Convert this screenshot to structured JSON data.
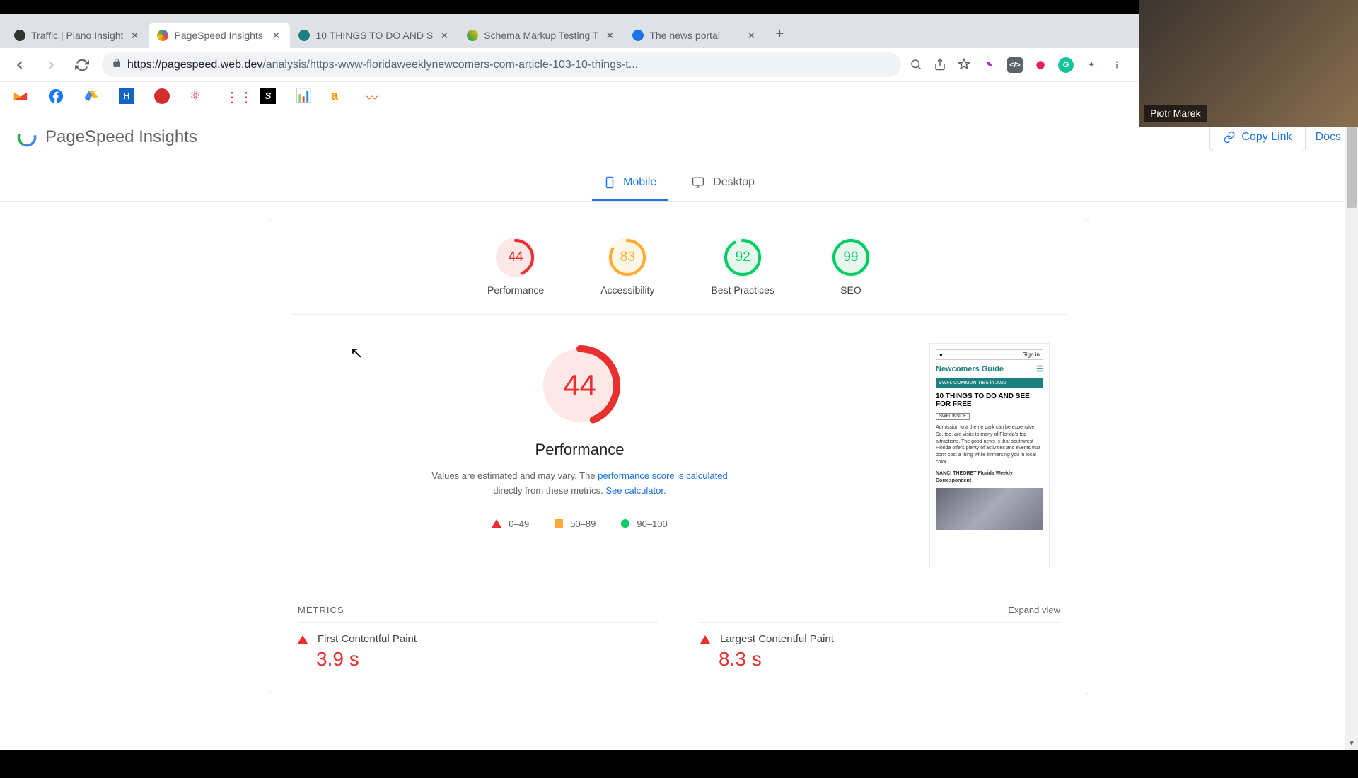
{
  "browser": {
    "tabs": [
      {
        "title": "Traffic | Piano Insight",
        "favicon": "#333"
      },
      {
        "title": "PageSpeed Insights",
        "favicon": "#4285f4",
        "active": true
      },
      {
        "title": "10 THINGS TO DO AND S",
        "favicon": "#1a8080"
      },
      {
        "title": "Schema Markup Testing T",
        "favicon": "#0f9d58"
      },
      {
        "title": "The news portal",
        "favicon": "#1a73e8"
      }
    ],
    "url_domain": "https://pagespeed.web.dev",
    "url_path": "/analysis/https-www-floridaweeklynewcomers-com-article-103-10-things-t..."
  },
  "psi": {
    "title": "PageSpeed Insights",
    "copy_link": "Copy Link",
    "docs": "Docs",
    "device_mobile": "Mobile",
    "device_desktop": "Desktop"
  },
  "chart_data": {
    "type": "bar",
    "title": "Lighthouse category scores",
    "categories": [
      "Performance",
      "Accessibility",
      "Best Practices",
      "SEO"
    ],
    "values": [
      44,
      83,
      92,
      99
    ],
    "ylim": [
      0,
      100
    ],
    "thresholds": [
      {
        "range": "0–49",
        "color": "#e7302f"
      },
      {
        "range": "50–89",
        "color": "#fa3"
      },
      {
        "range": "90–100",
        "color": "#0c6"
      }
    ]
  },
  "gauges": [
    {
      "score": "44",
      "label": "Performance",
      "color": "#e7302f",
      "bg": "#fde7e7",
      "pct": 44
    },
    {
      "score": "83",
      "label": "Accessibility",
      "color": "#fa3",
      "bg": "#fff7e6",
      "pct": 83
    },
    {
      "score": "92",
      "label": "Best Practices",
      "color": "#0c6",
      "bg": "#e6f7ed",
      "pct": 92
    },
    {
      "score": "99",
      "label": "SEO",
      "color": "#0c6",
      "bg": "#e6f7ed",
      "pct": 99
    }
  ],
  "performance": {
    "score": "44",
    "title": "Performance",
    "desc_pre": "Values are estimated and may vary. The ",
    "desc_link1": "performance score is calculated",
    "desc_mid": " directly from these metrics. ",
    "desc_link2": "See calculator",
    "desc_post": ".",
    "legend": [
      "0–49",
      "50–89",
      "90–100"
    ]
  },
  "screenshot": {
    "signin": "Sign in",
    "brand": "Newcomers Guide",
    "banner": "SWFL COMMUNITIES in 2022",
    "title": "10 THINGS TO DO AND SEE FOR FREE",
    "tag": "SWFL INSIDE",
    "text": "Admission to a theme park can be expensive. So, too, are visits to many of Florida's top attractions. The good news is that southwest Florida offers plenty of activities and events that don't cost a thing while immersing you in local color.",
    "byline": "NANCI THEORET Florida Weekly Correspondent"
  },
  "metrics": {
    "header": "METRICS",
    "expand": "Expand view",
    "items": [
      {
        "name": "First Contentful Paint",
        "value": "3.9 s"
      },
      {
        "name": "Largest Contentful Paint",
        "value": "8.3 s"
      }
    ]
  },
  "webcam_name": "Piotr Marek"
}
